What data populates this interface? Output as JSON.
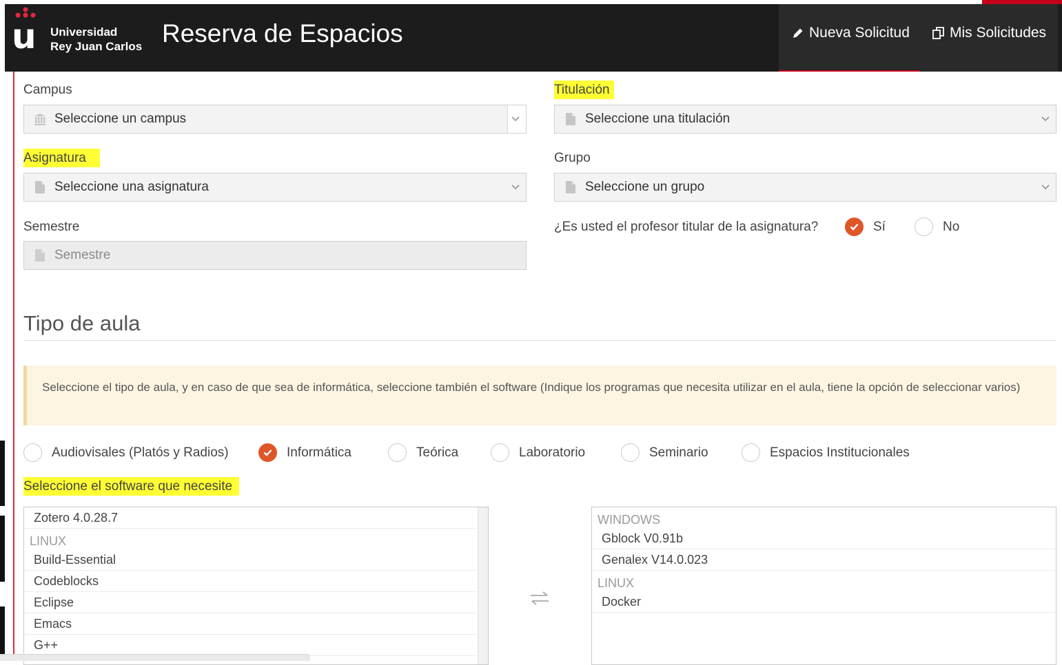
{
  "header": {
    "university_line1": "Universidad",
    "university_line2": "Rey Juan Carlos",
    "logo_icon": "urjc-crown-logo",
    "app_title": "Reserva de Espacios",
    "nav": [
      {
        "label": "Nueva Solicitud",
        "icon": "pencil-icon"
      },
      {
        "label": "Mis Solicitudes",
        "icon": "copy-icon"
      }
    ],
    "accent_color": "#c6001a"
  },
  "form": {
    "campus": {
      "label": "Campus",
      "placeholder": "Seleccione un campus",
      "icon": "building-icon"
    },
    "titulacion": {
      "label": "Titulación",
      "placeholder": "Seleccione una titulación",
      "icon": "document-icon"
    },
    "asignatura": {
      "label": "Asignatura",
      "placeholder": "Seleccione una asignatura",
      "icon": "document-icon"
    },
    "grupo": {
      "label": "Grupo",
      "placeholder": "Seleccione un grupo",
      "icon": "document-icon"
    },
    "semestre": {
      "label": "Semestre",
      "placeholder": "Semestre",
      "icon": "document-icon"
    },
    "profesor": {
      "question": "¿Es usted el profesor titular de la asignatura?",
      "options": [
        {
          "label": "Sí",
          "checked": true
        },
        {
          "label": "No",
          "checked": false
        }
      ]
    }
  },
  "aula": {
    "title": "Tipo de aula",
    "info": "Seleccione el tipo de aula, y en caso de que sea de informática, seleccione también el software (Indique los programas que necesita utilizar en el aula, tiene la opción de seleccionar varios)",
    "types": [
      {
        "label": "Audiovisales (Platós y Radios)",
        "checked": false
      },
      {
        "label": "Informática",
        "checked": true
      },
      {
        "label": "Teórica",
        "checked": false
      },
      {
        "label": "Laboratorio",
        "checked": false
      },
      {
        "label": "Seminario",
        "checked": false
      },
      {
        "label": "Espacios Institucionales",
        "checked": false
      }
    ],
    "accent_color": "#e05527"
  },
  "software": {
    "label": "Seleccione el software que necesite",
    "available": [
      {
        "type": "item",
        "text": "Zotero 4.0.28.7"
      },
      {
        "type": "group",
        "text": "LINUX"
      },
      {
        "type": "item",
        "text": "Build-Essential"
      },
      {
        "type": "item",
        "text": "Codeblocks"
      },
      {
        "type": "item",
        "text": "Eclipse"
      },
      {
        "type": "item",
        "text": "Emacs"
      },
      {
        "type": "item",
        "text": "G++"
      }
    ],
    "selected": [
      {
        "type": "group",
        "text": "WINDOWS"
      },
      {
        "type": "item",
        "text": "Gblock V0.91b"
      },
      {
        "type": "item",
        "text": "Genalex V14.0.023"
      },
      {
        "type": "group",
        "text": "LINUX"
      },
      {
        "type": "item",
        "text": "Docker"
      }
    ],
    "swap_icon": "swap-arrows-icon"
  },
  "highlight_color": "#ffff33"
}
